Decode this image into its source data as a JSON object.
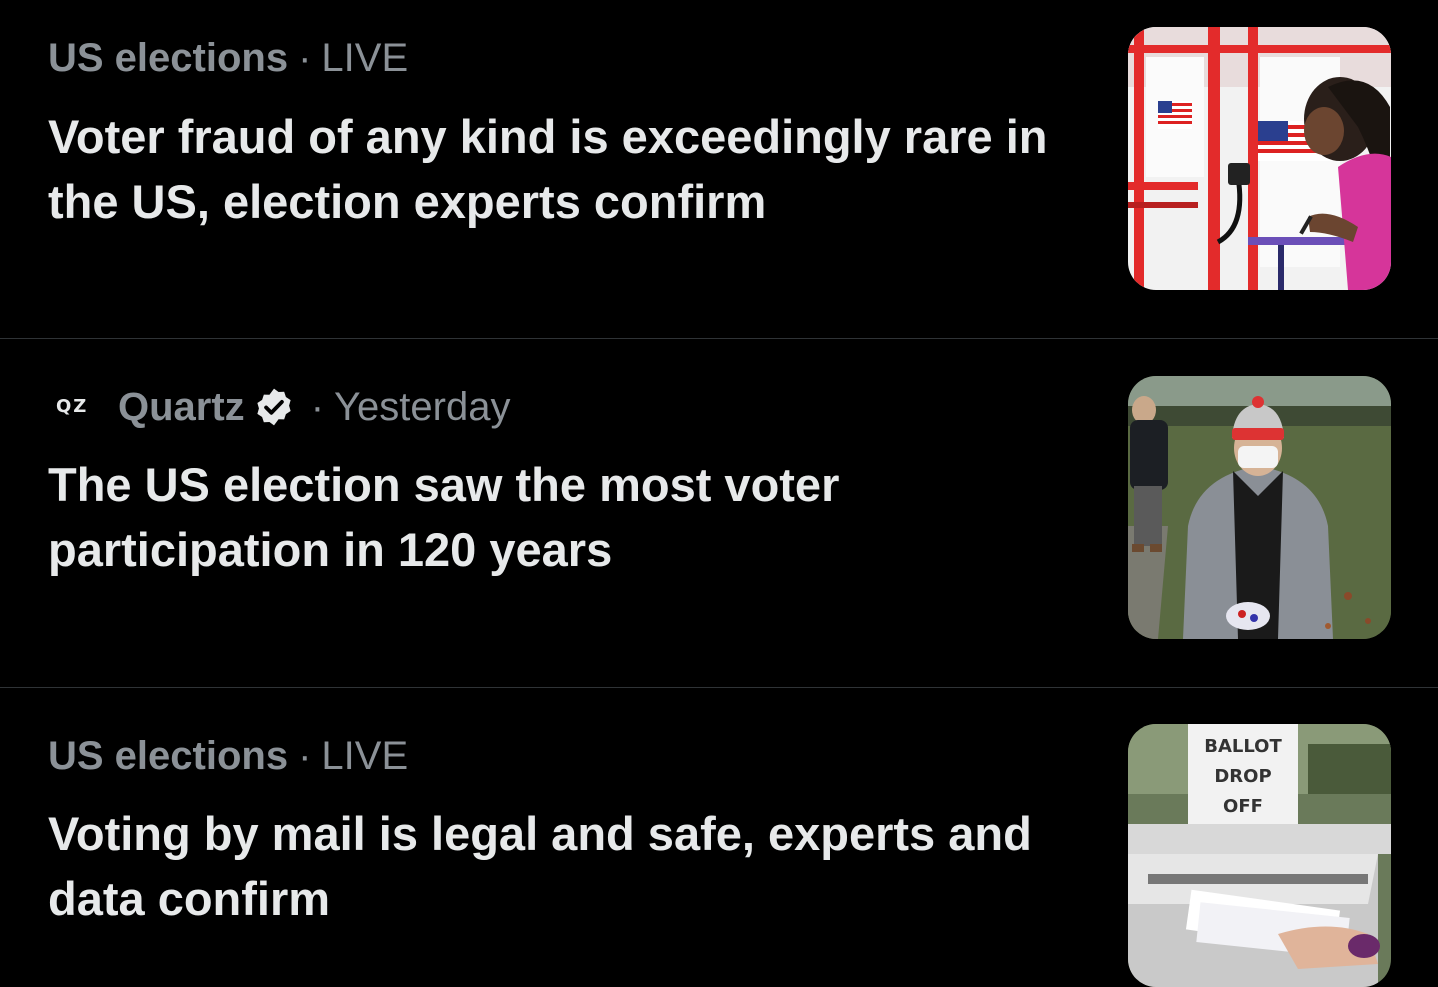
{
  "items": [
    {
      "topic": "US elections",
      "separator": "·",
      "status": "LIVE",
      "headline": "Voter fraud of any kind is exceedingly rare in the US, election experts confirm",
      "thumbnail_icon": "voting-booth-photo"
    },
    {
      "source_logo": "QZ",
      "source_name": "Quartz",
      "verified_icon": "verified-badge-icon",
      "separator": "·",
      "time": "Yesterday",
      "headline": "The US election saw the most voter participation in 120 years",
      "thumbnail_icon": "voter-in-line-photo"
    },
    {
      "topic": "US elections",
      "separator": "·",
      "status": "LIVE",
      "headline": "Voting by mail is legal and safe, experts and data confirm",
      "thumbnail_icon": "ballot-drop-off-photo",
      "thumbnail_sign": [
        "BALLOT",
        "DROP",
        "OFF"
      ]
    }
  ],
  "colors": {
    "background": "#000000",
    "headline": "#e7e9ea",
    "meta": "#8b9197",
    "divider": "#2f3336"
  }
}
